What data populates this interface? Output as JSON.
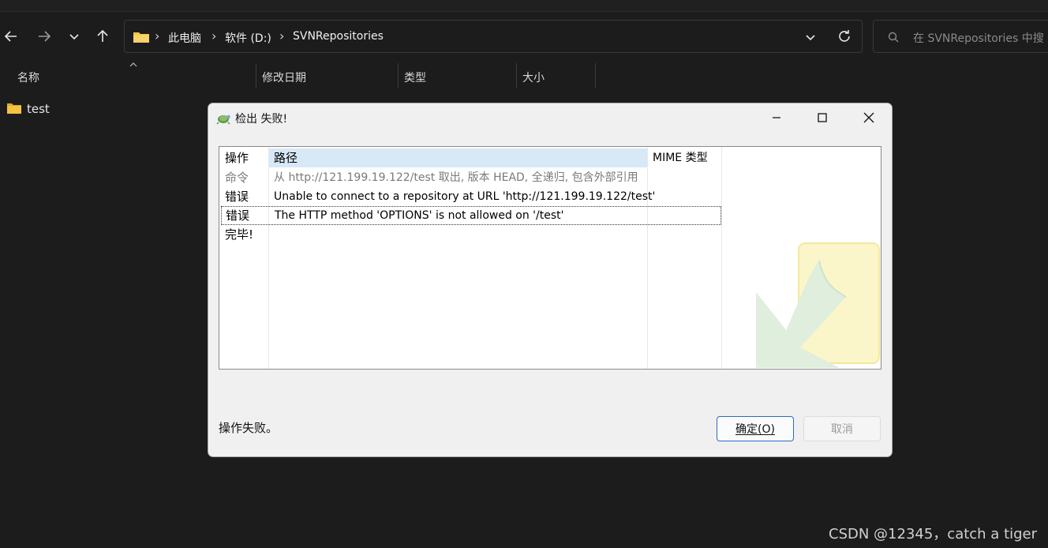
{
  "explorer": {
    "address": {
      "crumbs": [
        "此电脑",
        "软件 (D:)",
        "SVNRepositories"
      ]
    },
    "search_placeholder": "在 SVNRepositories 中搜",
    "columns": [
      "名称",
      "修改日期",
      "类型",
      "大小"
    ],
    "items": [
      {
        "name": "test",
        "type": "folder"
      }
    ]
  },
  "dialog": {
    "title": "检出 失败!",
    "headers": {
      "action": "操作",
      "path": "路径",
      "mime": "MIME 类型"
    },
    "rows": [
      {
        "action": "命令",
        "path": "从 http://121.199.19.122/test 取出, 版本 HEAD, 全递归, 包含外部引用",
        "style": "gray"
      },
      {
        "action": "错误",
        "path": "Unable to connect to a repository at URL 'http://121.199.19.122/test'",
        "style": "normal"
      },
      {
        "action": "错误",
        "path": "The HTTP method 'OPTIONS' is not allowed on '/test'",
        "style": "focused"
      },
      {
        "action": "完毕!",
        "path": "",
        "style": "normal"
      }
    ],
    "status": "操作失败。",
    "ok_label": "确定(O)",
    "cancel_label": "取消"
  },
  "watermark": "CSDN @12345，catch a tiger",
  "colors": {
    "accent": "#2a6cc4",
    "header_highlight": "#d7e8f7",
    "folder": "#f4c441"
  },
  "icons": [
    "back-arrow-icon",
    "forward-arrow-icon",
    "chevron-down-icon",
    "up-arrow-icon",
    "folder-icon",
    "refresh-icon",
    "search-icon",
    "tortoise-icon",
    "minimize-icon",
    "maximize-icon",
    "close-icon"
  ]
}
